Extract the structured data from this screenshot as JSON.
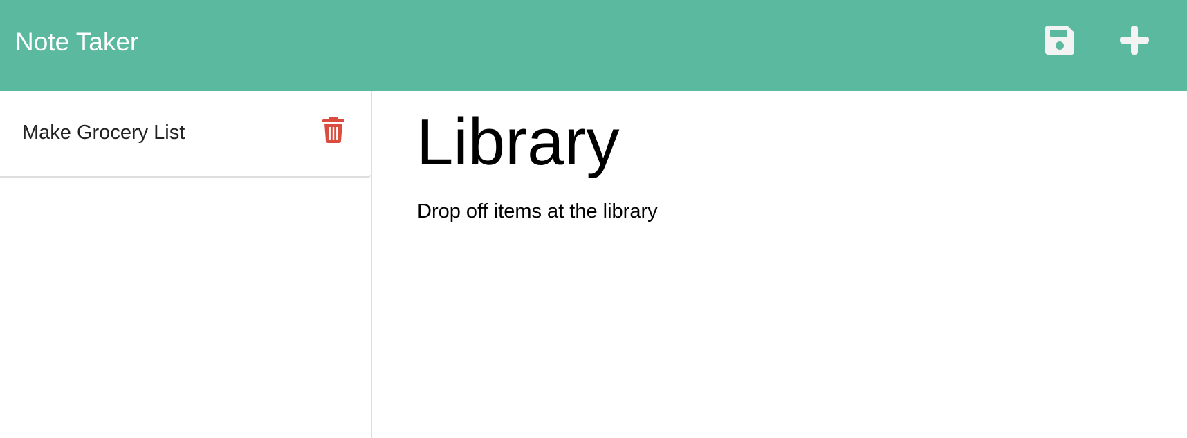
{
  "app": {
    "title": "Note Taker"
  },
  "header": {
    "save_icon": "save-icon",
    "new_icon": "plus-icon",
    "icon_color": "#f3f3f3",
    "background_color": "#5ab99e"
  },
  "sidebar": {
    "notes": [
      {
        "title": "Make Grocery List",
        "delete_icon": "trash-icon",
        "delete_color": "#dc4c3e"
      }
    ]
  },
  "main": {
    "note_title": "Library",
    "note_text": "Drop off items at the library"
  }
}
